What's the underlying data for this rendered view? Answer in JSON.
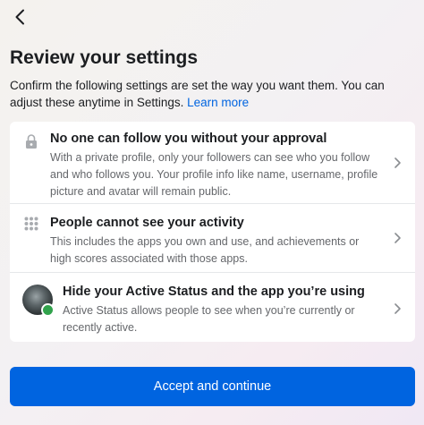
{
  "header": {
    "back_icon": "chevron-left-icon"
  },
  "title": "Review your settings",
  "subtitle": {
    "text": "Confirm the following settings are set the way you want them. You can adjust these anytime in Settings.",
    "link": "Learn more"
  },
  "settings": [
    {
      "icon": "lock-icon",
      "title": "No one can follow you without your approval",
      "description": "With a private profile, only your followers can see who you follow and who follows you. Your profile info like name, username, profile picture and avatar will remain public."
    },
    {
      "icon": "activity-grid-icon",
      "title": "People cannot see your activity",
      "description": "This includes the apps you own and use, and achievements or high scores associated with those apps."
    },
    {
      "icon": "avatar",
      "title": "Hide your Active Status and the app you’re using",
      "description": "Active Status allows people to see when you’re currently or recently active."
    }
  ],
  "accept_button": "Accept and continue",
  "colors": {
    "accent": "#0064e0",
    "online": "#31a24c"
  }
}
